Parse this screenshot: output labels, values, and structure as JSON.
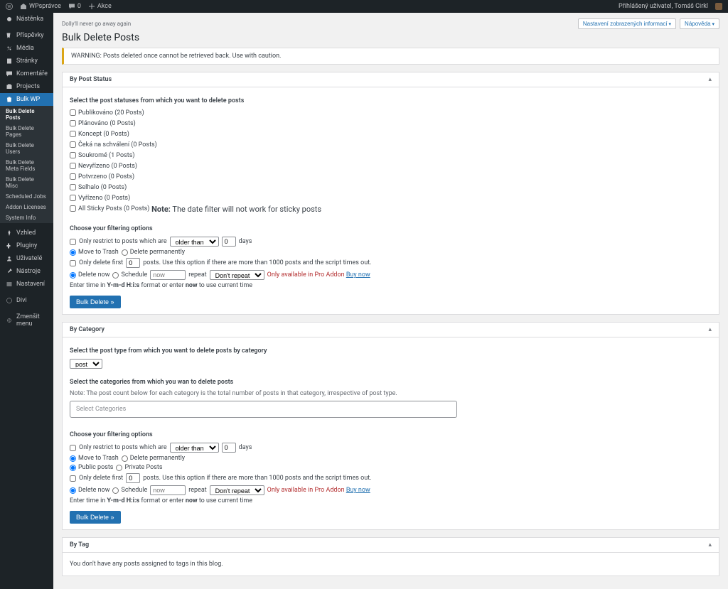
{
  "adminbar": {
    "site": "WPsprávce",
    "comments": "0",
    "add": "Akce",
    "quote": "Dolly'll never go away again",
    "greeting": "Přihlášený uživatel, Tomáš Cirkl",
    "screen_options": "Nastavení zobrazených informací",
    "help": "Nápověda"
  },
  "sidebar": {
    "items": [
      {
        "label": "Nástěnka"
      },
      {
        "label": "Příspěvky"
      },
      {
        "label": "Média"
      },
      {
        "label": "Stránky"
      },
      {
        "label": "Komentáře"
      },
      {
        "label": "Projects"
      },
      {
        "label": "Bulk WP",
        "current": true
      }
    ],
    "submenu": [
      {
        "label": "Bulk Delete Posts",
        "current": true
      },
      {
        "label": "Bulk Delete Pages"
      },
      {
        "label": "Bulk Delete Users"
      },
      {
        "label": "Bulk Delete Meta Fields"
      },
      {
        "label": "Bulk Delete Misc"
      },
      {
        "label": "Scheduled Jobs"
      },
      {
        "label": "Addon Licenses"
      },
      {
        "label": "System Info"
      }
    ],
    "items2": [
      {
        "label": "Vzhled"
      },
      {
        "label": "Pluginy"
      },
      {
        "label": "Uživatelé"
      },
      {
        "label": "Nástroje"
      },
      {
        "label": "Nastavení"
      }
    ],
    "items3": [
      {
        "label": "Divi"
      }
    ],
    "collapse": "Zmenšit menu"
  },
  "page": {
    "title": "Bulk Delete Posts",
    "warning": "WARNING: Posts deleted once cannot be retrieved back. Use with caution."
  },
  "status_box": {
    "title": "By Post Status",
    "select_label": "Select the post statuses from which you want to delete posts",
    "statuses": [
      "Publikováno (20 Posts)",
      "Plánováno (0 Posts)",
      "Koncept (0 Posts)",
      "Čeká na schválení (0 Posts)",
      "Soukromé (1 Posts)",
      "Nevyřízeno (0 Posts)",
      "Potvrzeno (0 Posts)",
      "Selhalo (0 Posts)",
      "Vyřízeno (0 Posts)"
    ],
    "sticky_label": "All Sticky Posts (0 Posts)",
    "sticky_note_pre": "Note:",
    "sticky_note": "The date filter will not work for sticky posts"
  },
  "filter": {
    "heading": "Choose your filtering options",
    "restrict_label": "Only restrict to posts which are",
    "older_than": "older than",
    "days": "days",
    "days_val": "0",
    "move_trash": "Move to Trash",
    "del_perm": "Delete permanently",
    "only_first": "Only delete first",
    "only_first_val": "0",
    "only_first_post": "posts. Use this option if there are more than 1000 posts and the script times out.",
    "delete_now": "Delete now",
    "schedule": "Schedule",
    "now_placeholder": "now",
    "repeat": "repeat",
    "dont_repeat": "Don't repeat",
    "pro_only": "Only available in Pro Addon",
    "buy_now": "Buy now",
    "time_note_pre": "Enter time in",
    "time_fmt": "Y-m-d H:i:s",
    "time_note_mid": "format or enter",
    "time_now": "now",
    "time_note_post": "to use current time",
    "button": "Bulk Delete »"
  },
  "cat_box": {
    "title": "By Category",
    "select_type": "Select the post type from which you want to delete posts by category",
    "post_opt": "post",
    "select_cats_label": "Select the categories from which you wan to delete posts",
    "note": "Note: The post count below for each category is the total number of posts in that category, irrespective of post type.",
    "placeholder": "Select Categories",
    "public_posts": "Public posts",
    "private_posts": "Private Posts"
  },
  "tag_box": {
    "title": "By Tag",
    "empty": "You don't have any posts assigned to tags in this blog."
  }
}
